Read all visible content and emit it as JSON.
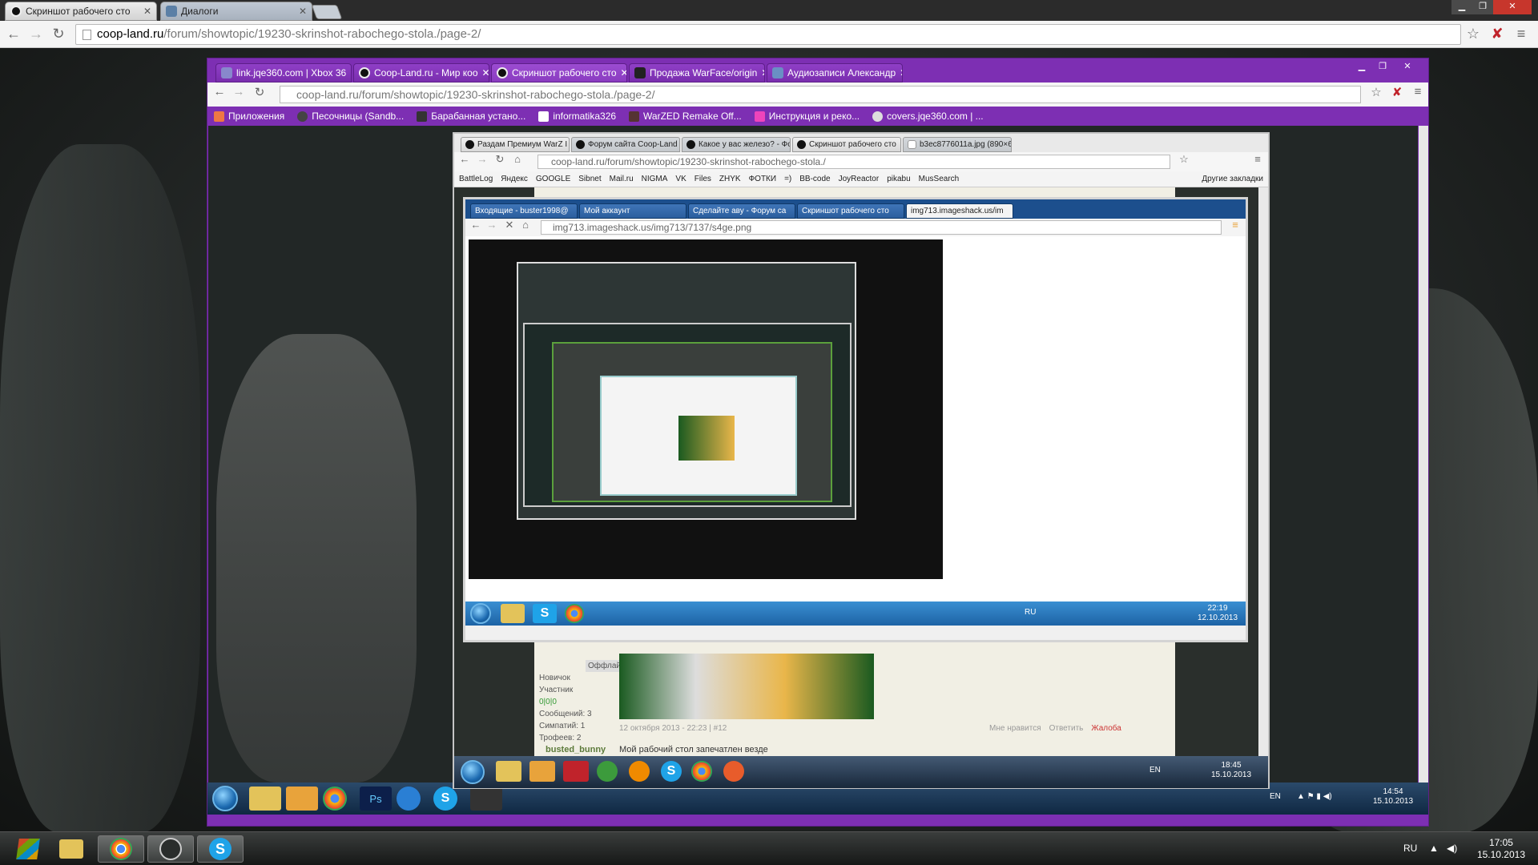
{
  "outer_browser": {
    "tabs": [
      {
        "label": "Скриншот рабочего сто",
        "active": true
      },
      {
        "label": "Диалоги",
        "active": false
      }
    ],
    "address": {
      "host": "coop-land.ru",
      "path": "/forum/showtopic/19230-skrinshot-rabochego-stola./page-2/"
    }
  },
  "level2": {
    "tabs": [
      {
        "label": "link.jqe360.com | Xbox 36"
      },
      {
        "label": "Coop-Land.ru - Мир коо"
      },
      {
        "label": "Скриншот рабочего сто"
      },
      {
        "label": "Продажа WarFace/origin"
      },
      {
        "label": "Аудиозаписи Александр"
      }
    ],
    "address": {
      "host": "coop-land.ru",
      "path": "/forum/showtopic/19230-skrinshot-rabochego-stola./page-2/"
    },
    "bookmarks": [
      "Приложения",
      "Песочницы (Sandb...",
      "Барабанная устано...",
      "informatika326",
      "WarZED Remake Off...",
      "Инструкция и реко...",
      "covers.jqe360.com | ..."
    ],
    "taskbar": {
      "lang": "EN",
      "time": "14:54",
      "date": "15.10.2013"
    }
  },
  "level3": {
    "tabs": [
      {
        "label": "Раздам Премиум WarZ I"
      },
      {
        "label": "Форум сайта Coop-Land"
      },
      {
        "label": "Какое у вас железо? - Фо"
      },
      {
        "label": "Скриншот рабочего сто"
      },
      {
        "label": "b3ec8776011a.jpg (890×6"
      }
    ],
    "address": {
      "host": "coop-land.ru",
      "path": "/forum/showtopic/19230-skrinshot-rabochego-stola./"
    },
    "bookmarks": [
      "BattleLog",
      "Яндекс",
      "GOOGLE",
      "Sibnet",
      "Mail.ru",
      "NIGMA",
      "VK",
      "Files",
      "ZHYK",
      "ФОТКИ",
      "=)",
      "BB-code",
      "JoyReactor",
      "pikabu",
      "MusSearch",
      "Другие закладки"
    ],
    "forum": {
      "rank": "Новичок",
      "group": "Участник",
      "rep": "0|0|0",
      "posts": "Сообщений: 3",
      "likes": "Симпатий: 1",
      "trophies": "Трофеев: 2",
      "offline": "Оффлайн",
      "post_date": "12 октября 2013 - 22:23 | #12",
      "actions": [
        "Мне нравится",
        "Ответить",
        "Жалоба"
      ],
      "next_user": "busted_bunny",
      "next_text": "Мой рабочий стол запечатлен везде"
    },
    "taskbar": {
      "lang": "EN",
      "time": "18:45",
      "date": "15.10.2013"
    }
  },
  "level4": {
    "tabs": [
      {
        "label": "Входящие - buster1998@"
      },
      {
        "label": "Мой аккаунт"
      },
      {
        "label": "Сделайте аву - Форум са"
      },
      {
        "label": "Скриншот рабочего сто"
      },
      {
        "label": "img713.imageshack.us/im"
      }
    ],
    "address": {
      "host": "img713.imageshack.us",
      "path": "/img713/7137/s4ge.png"
    },
    "taskbar": {
      "lang": "RU",
      "time": "22:19",
      "date": "12.10.2013"
    }
  },
  "taskbar": {
    "lang": "RU",
    "time": "17:05",
    "date": "15.10.2013"
  },
  "colors": {
    "level2_accent": "#7d2fb3",
    "level4_accent": "#1c4f8d"
  }
}
